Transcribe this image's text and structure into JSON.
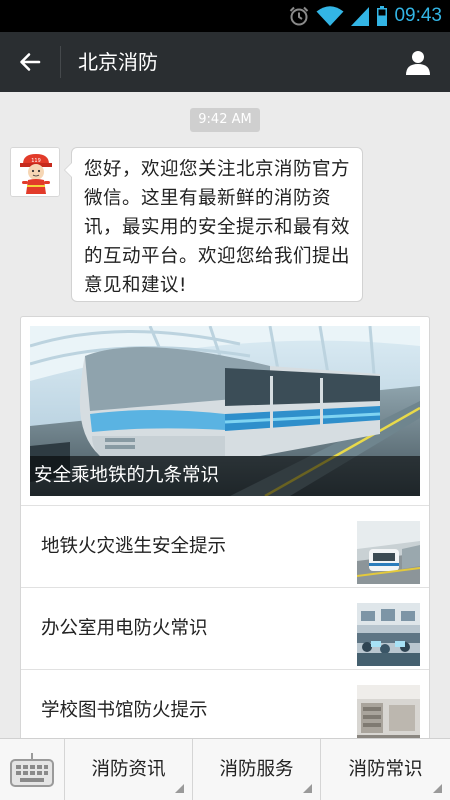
{
  "status_bar": {
    "time": "09:43",
    "icons": [
      "alarm-icon",
      "wifi-icon",
      "signal-icon",
      "battery-icon"
    ]
  },
  "header": {
    "title": "北京消防",
    "back_icon": "back-arrow-icon",
    "profile_icon": "person-icon"
  },
  "chat": {
    "timestamp": "9:42 AM",
    "message": "您好，欢迎您关注北京消防官方微信。这里有最新鲜的消防资讯，最实用的安全提示和最有效的互动平台。欢迎您给我们提出意见和建议!",
    "news_card": {
      "featured_title": "安全乘地铁的九条常识",
      "items": [
        {
          "title": "地铁火灾逃生安全提示"
        },
        {
          "title": "办公室用电防火常识"
        },
        {
          "title": "学校图书馆防火提示"
        }
      ]
    }
  },
  "bottom_menu": {
    "keyboard_icon": "keyboard-icon",
    "items": [
      {
        "label": "消防资讯"
      },
      {
        "label": "消防服务"
      },
      {
        "label": "消防常识"
      }
    ]
  },
  "colors": {
    "title_bar": "#2a2e31",
    "status_accent": "#33b5e5",
    "chat_bg": "#ebebeb"
  }
}
